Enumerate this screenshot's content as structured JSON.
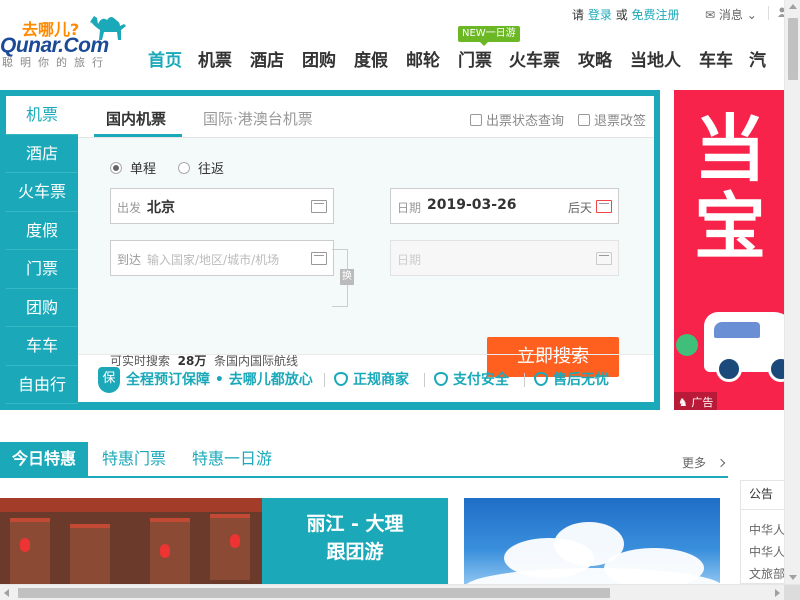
{
  "topbar": {
    "please": "请",
    "login": "登录",
    "or": "或",
    "register": "免费注册",
    "messages": "消息"
  },
  "logo": {
    "slogan": "去哪儿?",
    "brand": "Qunar.Com",
    "tagline": "聪明你的旅行"
  },
  "nav": {
    "items": [
      "首页",
      "机票",
      "酒店",
      "团购",
      "度假",
      "邮轮",
      "门票",
      "火车票",
      "攻略",
      "当地人",
      "车车",
      "汽"
    ],
    "new_badge": "NEW一日游"
  },
  "search": {
    "side_tabs": [
      "机票",
      "酒店",
      "火车票",
      "度假",
      "门票",
      "团购",
      "车车",
      "自由行"
    ],
    "tabs": [
      "国内机票",
      "国际·港澳台机票"
    ],
    "status_link": "出票状态查询",
    "refund_link": "退票改签",
    "trip_types": [
      "单程",
      "往返"
    ],
    "from_label": "出发",
    "from_value": "北京",
    "to_label": "到达",
    "to_placeholder": "输入国家/地区/城市/机场",
    "date_label": "日期",
    "date_value": "2019-03-26",
    "date_hint": "后天",
    "return_date_label": "日期",
    "swap_label": "换",
    "stat_prefix": "可实时搜索",
    "stat_count": "28万",
    "stat_suffix": "条国内国际航线",
    "search_button": "立即搜索",
    "shield": "保",
    "guarantee_main": "全程预订保障 • 去哪儿都放心",
    "guarantee_items": [
      "正规商家",
      "支付安全",
      "售后无忧"
    ]
  },
  "ad": {
    "big_text": "当\n宝",
    "label": "广告"
  },
  "deals": {
    "tabs": [
      "今日特惠",
      "特惠门票",
      "特惠一日游"
    ],
    "more": "更多",
    "card1_caption_line1": "丽江 - 大理",
    "card1_caption_line2": "跟团游"
  },
  "notice": {
    "title": "公告",
    "items": [
      "中华人",
      "中华人",
      "文旅部"
    ]
  },
  "colors": {
    "accent": "#1ba9ba",
    "search_button": "#ff6020",
    "ad_background": "#f7234a",
    "brand": "#1b4a96"
  }
}
